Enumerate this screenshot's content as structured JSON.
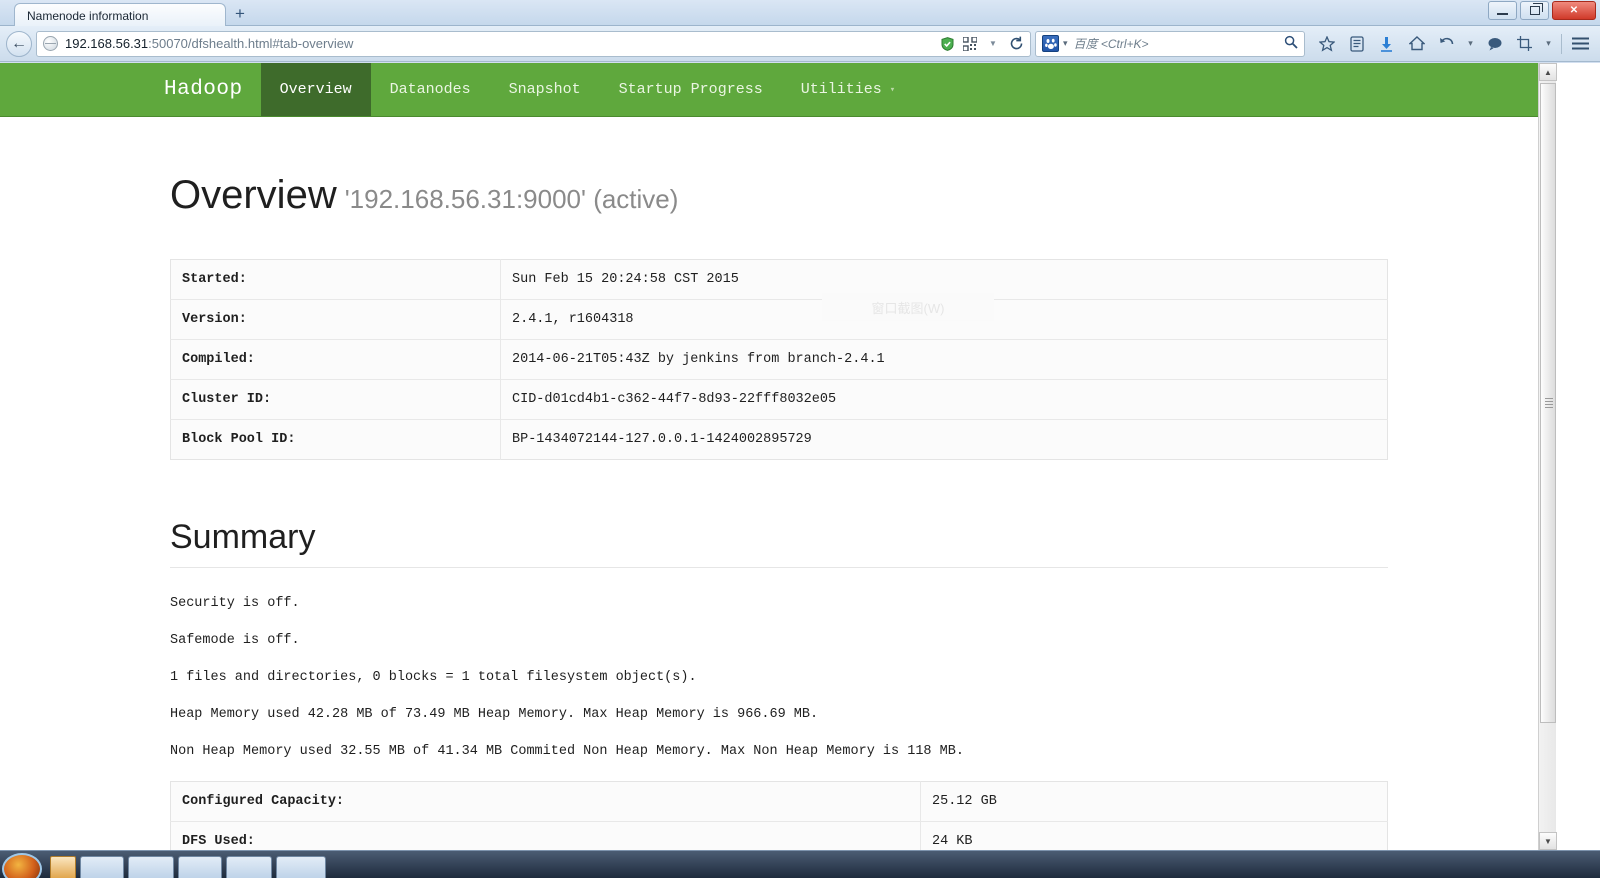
{
  "browser": {
    "tab_title": "Namenode information",
    "new_tab_label": "+",
    "back_icon": "←",
    "url_host": "192.168.56.31",
    "url_rest": ":50070/dfshealth.html#tab-overview",
    "search_placeholder": "百度 <Ctrl+K>",
    "search_engine_glyph": "🐾",
    "window_minimize": "–",
    "window_restore": "❐",
    "window_close": "✕",
    "toolbar_icons": [
      {
        "name": "shield-icon",
        "glyph": "⛨"
      },
      {
        "name": "qrcode-icon",
        "glyph": "▒"
      },
      {
        "name": "chevron-down-icon",
        "glyph": "▼"
      },
      {
        "name": "reload-icon",
        "glyph": "↻"
      },
      {
        "name": "search-icon",
        "glyph": "⌕"
      },
      {
        "name": "bookmark-star-icon",
        "glyph": "☆"
      },
      {
        "name": "reading-list-icon",
        "glyph": "▤"
      },
      {
        "name": "download-icon",
        "glyph": "⬇"
      },
      {
        "name": "home-icon",
        "glyph": "⌂"
      },
      {
        "name": "undo-icon",
        "glyph": "↶"
      },
      {
        "name": "dropdown-icon",
        "glyph": "▾"
      },
      {
        "name": "comment-icon",
        "glyph": "💬"
      },
      {
        "name": "screenshot-icon",
        "glyph": "⛶"
      },
      {
        "name": "dropdown-icon-2",
        "glyph": "▾"
      },
      {
        "name": "menu-icon",
        "glyph": "☰"
      }
    ]
  },
  "hadoop_nav": {
    "brand": "Hadoop",
    "items": [
      {
        "label": "Overview",
        "active": true
      },
      {
        "label": "Datanodes",
        "active": false
      },
      {
        "label": "Snapshot",
        "active": false
      },
      {
        "label": "Startup Progress",
        "active": false
      },
      {
        "label": "Utilities",
        "active": false,
        "caret": "▾"
      }
    ]
  },
  "overview": {
    "title": "Overview",
    "subtitle": "'192.168.56.31:9000' (active)",
    "info_rows": [
      {
        "key": "Started:",
        "value": "Sun Feb 15 20:24:58 CST 2015"
      },
      {
        "key": "Version:",
        "value": "2.4.1, r1604318"
      },
      {
        "key": "Compiled:",
        "value": "2014-06-21T05:43Z by jenkins from branch-2.4.1"
      },
      {
        "key": "Cluster ID:",
        "value": "CID-d01cd4b1-c362-44f7-8d93-22fff8032e05"
      },
      {
        "key": "Block Pool ID:",
        "value": "BP-1434072144-127.0.0.1-1424002895729"
      }
    ]
  },
  "summary": {
    "title": "Summary",
    "lines": [
      "Security is off.",
      "Safemode is off.",
      "1 files and directories, 0 blocks = 1 total filesystem object(s).",
      "Heap Memory used 42.28 MB of 73.49 MB Heap Memory. Max Heap Memory is 966.69 MB.",
      "Non Heap Memory used 32.55 MB of 41.34 MB Commited Non Heap Memory. Max Non Heap Memory is 118 MB."
    ],
    "capacity_rows": [
      {
        "key": "Configured Capacity:",
        "value": "25.12 GB"
      },
      {
        "key": "DFS Used:",
        "value": "24 KB"
      }
    ]
  },
  "artifacts": {
    "ghost_menu_text": "窗口截图(W)"
  },
  "scrollbar": {
    "up_glyph": "▲",
    "down_glyph": "▼"
  },
  "colors": {
    "nav_green": "#5fa83d",
    "nav_active_green": "#3e6b2b",
    "heading_text": "#1f1f1f",
    "subtitle_gray": "#8a8a8a"
  }
}
